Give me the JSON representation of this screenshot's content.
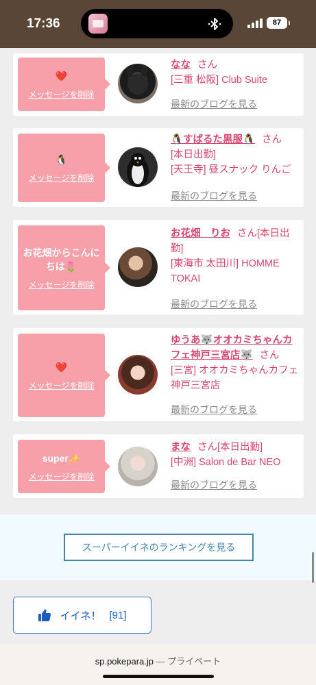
{
  "status": {
    "time": "17:36",
    "battery": "87"
  },
  "cards": [
    {
      "message": "❤️",
      "delete_label": "メッセージを削除",
      "name": "なな",
      "honorific": "さん",
      "detail_lines": [
        "[三重 松阪] Club Suite"
      ],
      "blog_label": "最新のブログを見る"
    },
    {
      "message": "🐧",
      "delete_label": "メッセージを削除",
      "name": "🐧すばるた黒服🐧",
      "honorific": "さん",
      "detail_lines": [
        "[本日出勤]",
        "[天王寺] 昼スナック りんご"
      ],
      "blog_label": "最新のブログを見る"
    },
    {
      "message": "お花畑からこんにちは🌷",
      "delete_label": "メッセージを削除",
      "name": "お花畑　りお",
      "honorific": "さん",
      "detail_lines": [
        "[本日出勤]",
        "[東海市 太田川] HOMME TOKAI"
      ],
      "blog_label": "最新のブログを見る"
    },
    {
      "message": "❤️",
      "delete_label": "メッセージを削除",
      "name": "ゆうあ🐺オオカミちゃんカフェ神戸三宮店🐺",
      "honorific": "さん",
      "detail_lines": [
        "[三宮] オオカミちゃんカフェ神戸三宮店"
      ],
      "blog_label": "最新のブログを見る"
    },
    {
      "message": "super✨",
      "delete_label": "メッセージを削除",
      "name": "まな",
      "honorific": "さん",
      "detail_lines": [
        "[本日出勤]",
        "[中洲] Salon de Bar NEO"
      ],
      "blog_label": "最新のブログを見る"
    }
  ],
  "ranking_button": "スーパーイイネのランキングを見る",
  "iine": {
    "label": "イイネ！",
    "count": "[91]"
  },
  "url_bar": {
    "host": "sp.pokepara.jp",
    "separator": " — ",
    "mode": "プライベート"
  }
}
